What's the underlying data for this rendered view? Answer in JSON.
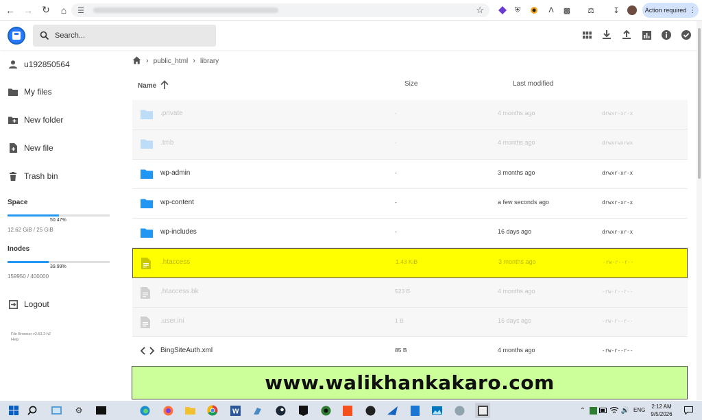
{
  "browser": {
    "action_required": "Action required"
  },
  "app": {
    "search_placeholder": "Search...",
    "header_icons": [
      "grid-view-icon",
      "download-icon",
      "upload-icon",
      "chart-icon",
      "info-icon",
      "select-icon"
    ]
  },
  "sidebar": {
    "user": "u192850564",
    "items": [
      {
        "label": "My files",
        "icon": "folder-icon"
      },
      {
        "label": "New folder",
        "icon": "new-folder-icon"
      },
      {
        "label": "New file",
        "icon": "new-file-icon"
      },
      {
        "label": "Trash bin",
        "icon": "trash-icon"
      }
    ],
    "space": {
      "label": "Space",
      "percent": "50.47%",
      "fraction": 0.5047,
      "used": "12.62 GiB / 25 GiB"
    },
    "inodes": {
      "label": "Inodes",
      "percent": "39.99%",
      "fraction": 0.3999,
      "used": "159950 / 400000"
    },
    "logout": "Logout",
    "credits": "File Browser v2.63.2-h2",
    "help": "Help"
  },
  "breadcrumbs": [
    "public_html",
    "library"
  ],
  "columns": {
    "name": "Name",
    "size": "Size",
    "modified": "Last modified"
  },
  "files": [
    {
      "name": ".private",
      "type": "folder",
      "size": "-",
      "modified": "4 months ago",
      "perms": "drwxr-xr-x",
      "state": "dim"
    },
    {
      "name": ".tmb",
      "type": "folder",
      "size": "-",
      "modified": "4 months ago",
      "perms": "drwxrwxrwx",
      "state": "dim"
    },
    {
      "name": "wp-admin",
      "type": "folder",
      "size": "-",
      "modified": "3 months ago",
      "perms": "drwxr-xr-x",
      "state": "normal"
    },
    {
      "name": "wp-content",
      "type": "folder",
      "size": "-",
      "modified": "a few seconds ago",
      "perms": "drwxr-xr-x",
      "state": "normal"
    },
    {
      "name": "wp-includes",
      "type": "folder",
      "size": "-",
      "modified": "16 days ago",
      "perms": "drwxr-xr-x",
      "state": "normal"
    },
    {
      "name": ".htaccess",
      "type": "file",
      "size": "1.43 KiB",
      "modified": "3 months ago",
      "perms": "-rw-r--r--",
      "state": "highlight"
    },
    {
      "name": ".htaccess.bk",
      "type": "file",
      "size": "523 B",
      "modified": "4 months ago",
      "perms": "-rw-r--r--",
      "state": "dim"
    },
    {
      "name": ".user.ini",
      "type": "file",
      "size": "1 B",
      "modified": "16 days ago",
      "perms": "-rw-r--r--",
      "state": "dim"
    },
    {
      "name": "BingSiteAuth.xml",
      "type": "code",
      "size": "85 B",
      "modified": "4 months ago",
      "perms": "-rw-r--r--",
      "state": "normal"
    }
  ],
  "banner": "www.walikhankakaro.com",
  "taskbar": {
    "lang": "ENG",
    "time": "2:12 AM",
    "date": "9/5/2026"
  },
  "colors": {
    "accent": "#2196f3",
    "folder": "#2196f3",
    "highlight": "#ffff00",
    "banner": "#ccff99"
  }
}
